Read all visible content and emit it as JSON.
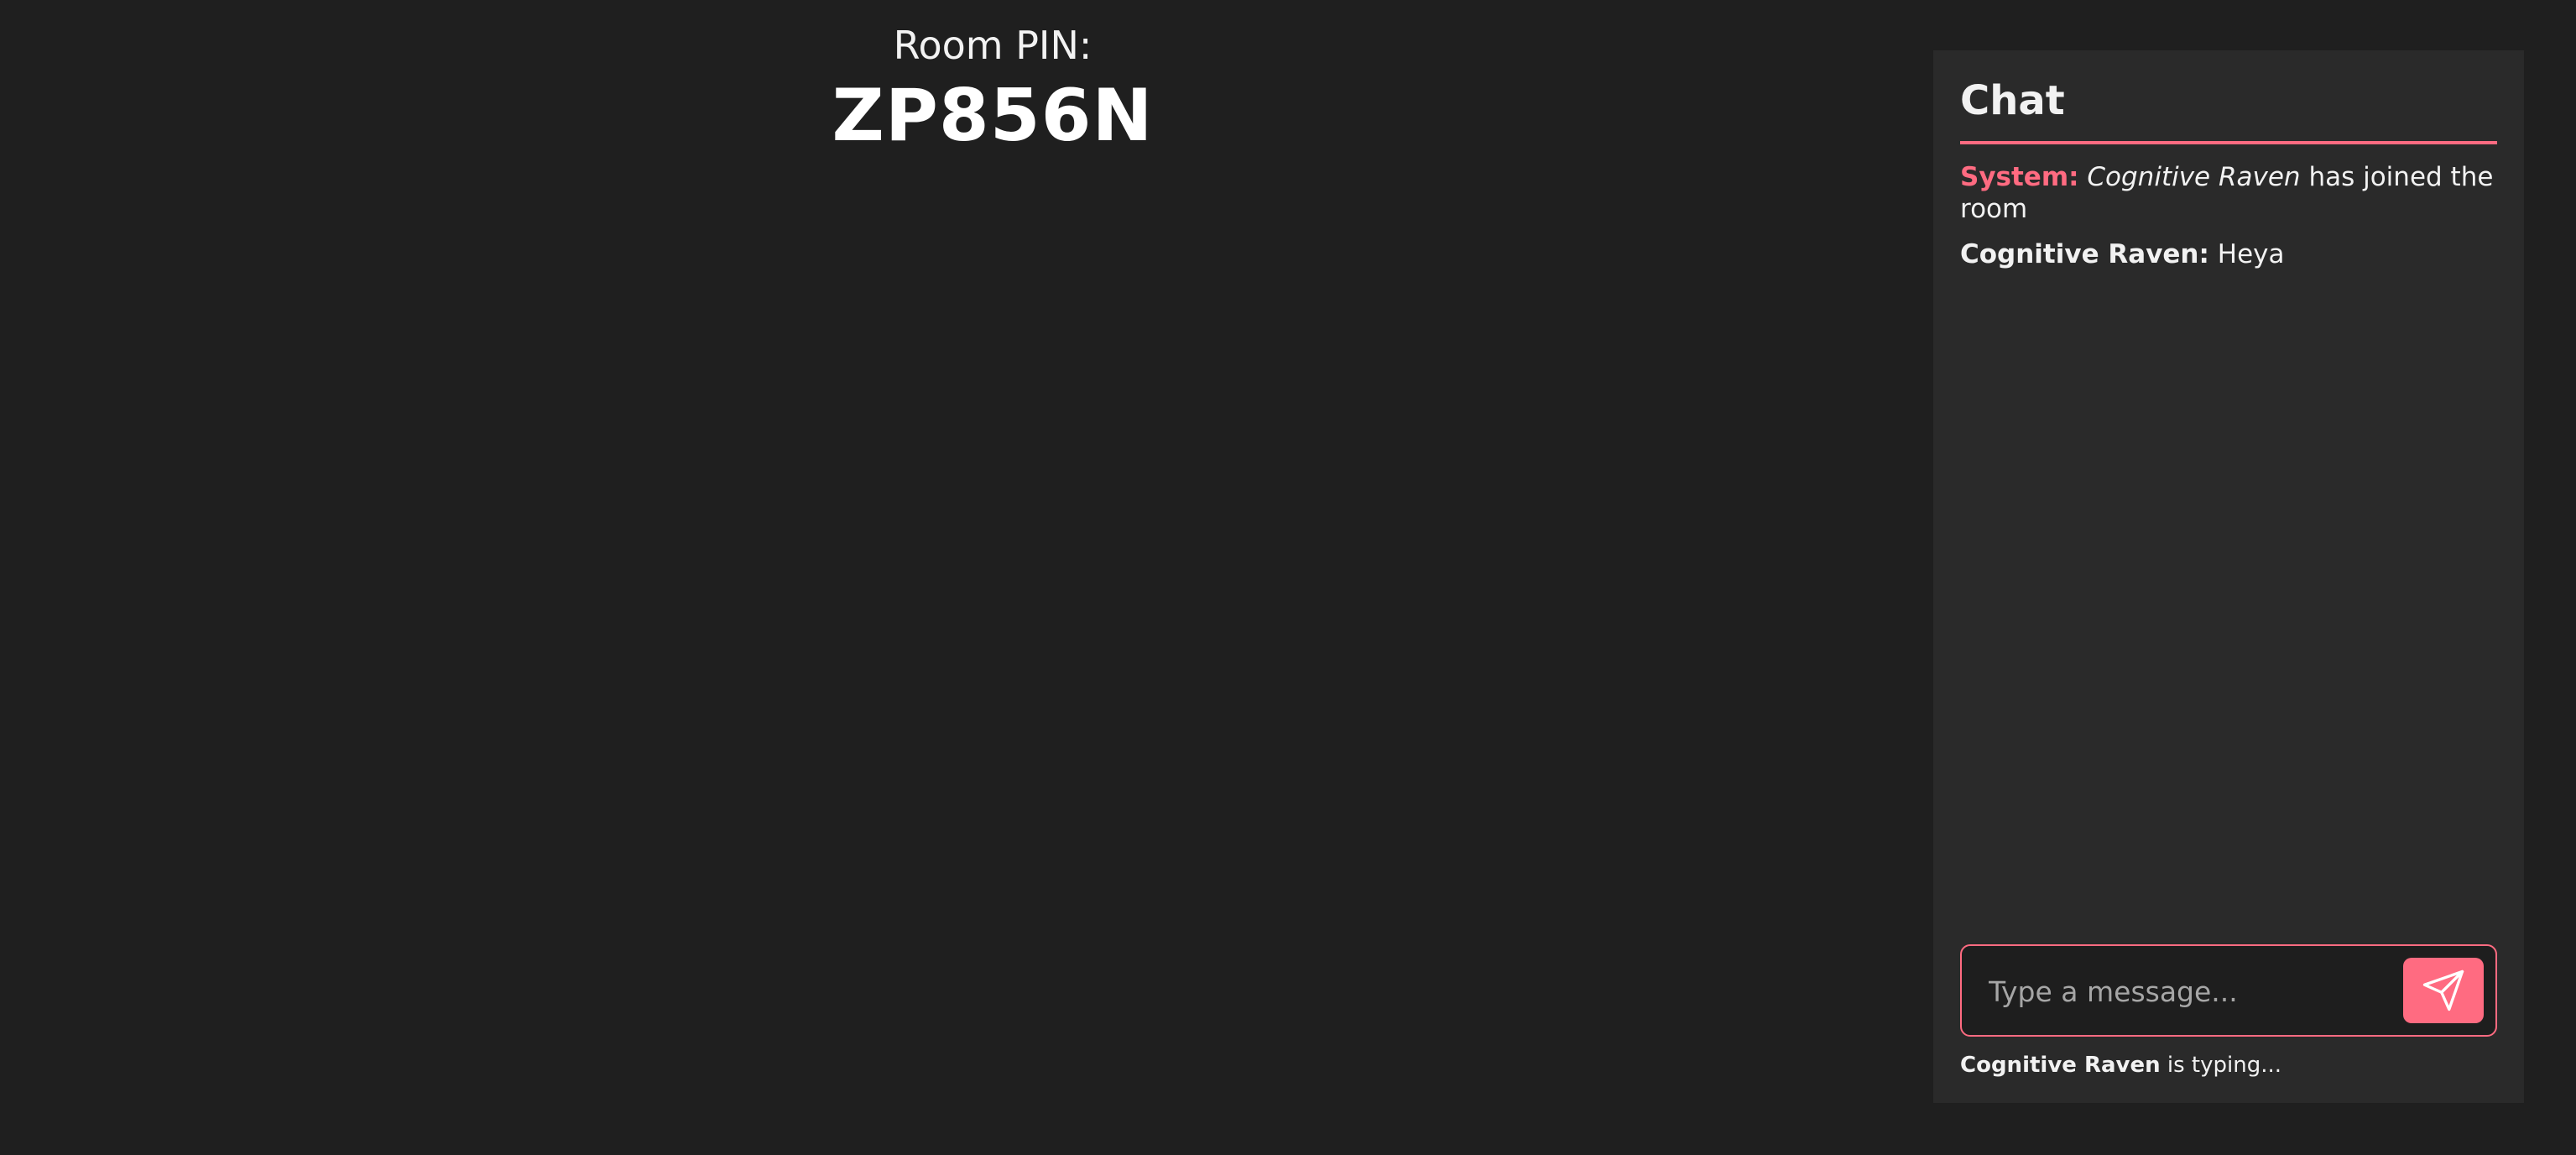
{
  "room": {
    "pin_label": "Room PIN:",
    "pin_value": "ZP856N"
  },
  "chat": {
    "title": "Chat",
    "messages": [
      {
        "sender": "System:",
        "subject": "Cognitive Raven",
        "text": "has joined the room",
        "kind": "system"
      },
      {
        "sender": "Cognitive Raven:",
        "text": "Heya",
        "kind": "user"
      }
    ],
    "input": {
      "placeholder": "Type a message...",
      "value": ""
    },
    "send_icon": "send-icon",
    "typing": {
      "name": "Cognitive Raven",
      "text": "is typing..."
    }
  },
  "colors": {
    "background": "#1f1f1f",
    "panel": "#2a2a2a",
    "accent": "#ff6b81",
    "text": "#f2f2f2"
  }
}
